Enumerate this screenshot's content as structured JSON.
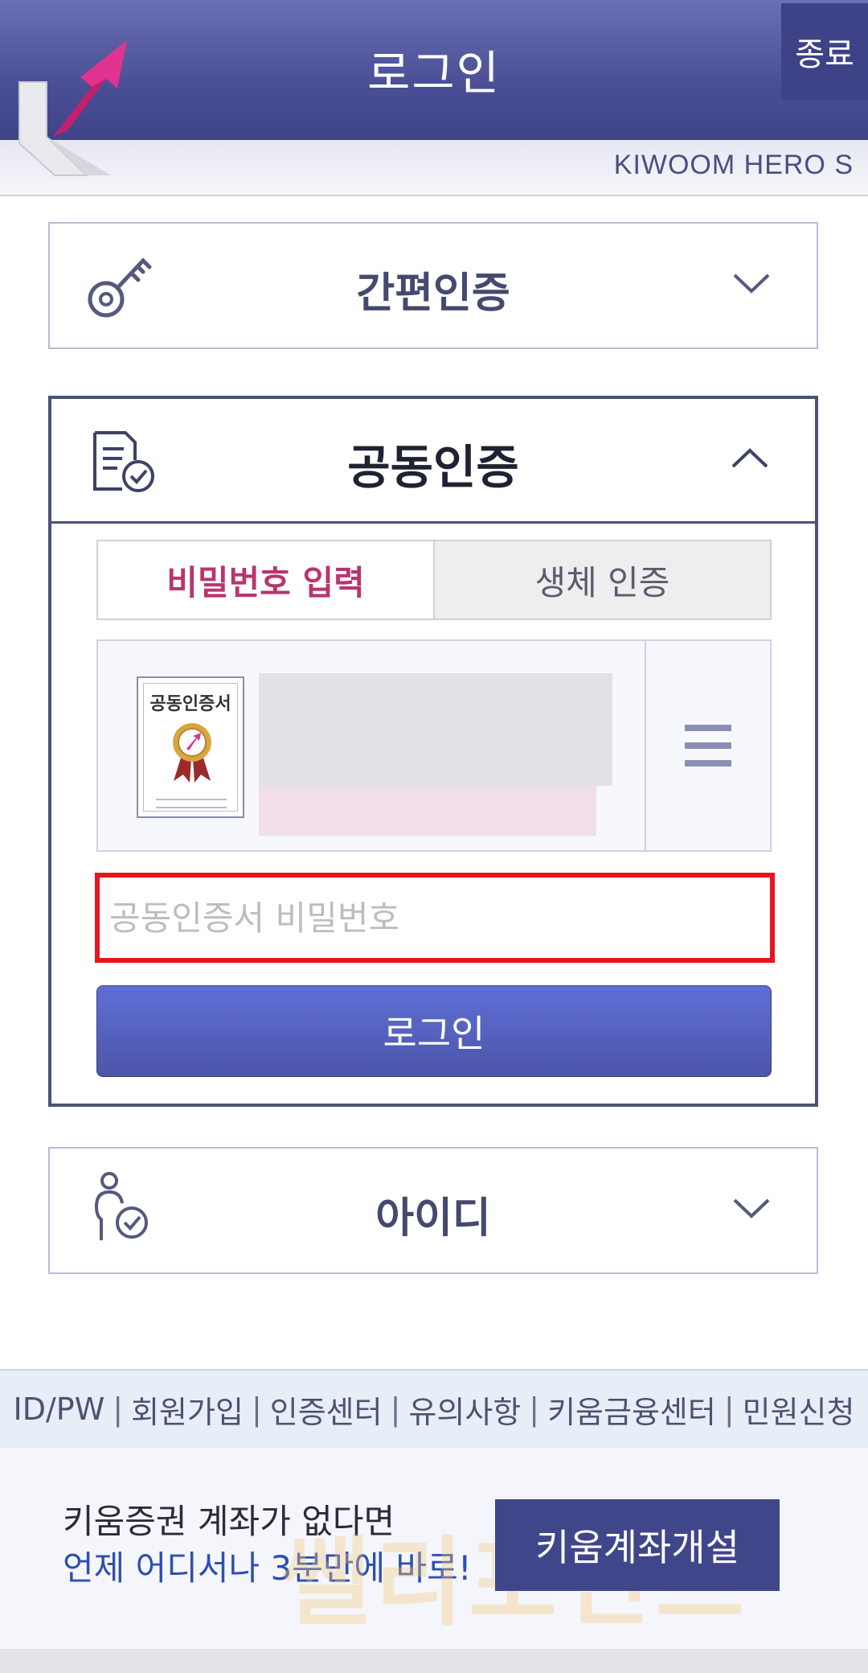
{
  "header": {
    "title": "로그인",
    "exit_label": "종료",
    "brand_text": "KIWOOM HERO S",
    "logo_icon": "kiwoom-k-arrow-logo",
    "accent_color": "#4a4f96",
    "logo_arrow_color": "#e0338f"
  },
  "sections": {
    "simple_auth": {
      "title": "간편인증",
      "icon": "key-icon",
      "expanded": false
    },
    "joint_cert": {
      "title": "공동인증",
      "icon": "certificate-document-icon",
      "expanded": true,
      "tabs": [
        {
          "label": "비밀번호 입력",
          "active": true
        },
        {
          "label": "생체 인증",
          "active": false
        }
      ],
      "cert_card_label": "공동인증서",
      "password_placeholder": "공동인증서 비밀번호",
      "password_value": "",
      "login_label": "로그인"
    },
    "id_login": {
      "title": "아이디",
      "icon": "person-check-icon",
      "expanded": false
    }
  },
  "footer_links": [
    "ID/PW",
    "회원가입",
    "인증센터",
    "유의사항",
    "키움금융센터",
    "민원신청"
  ],
  "promo": {
    "line1": "키움증권 계좌가 없다면",
    "line2": "언제 어디서나 3분만에 바로!",
    "button_label": "키움계좌개설",
    "watermark": "쌜리포인트"
  }
}
